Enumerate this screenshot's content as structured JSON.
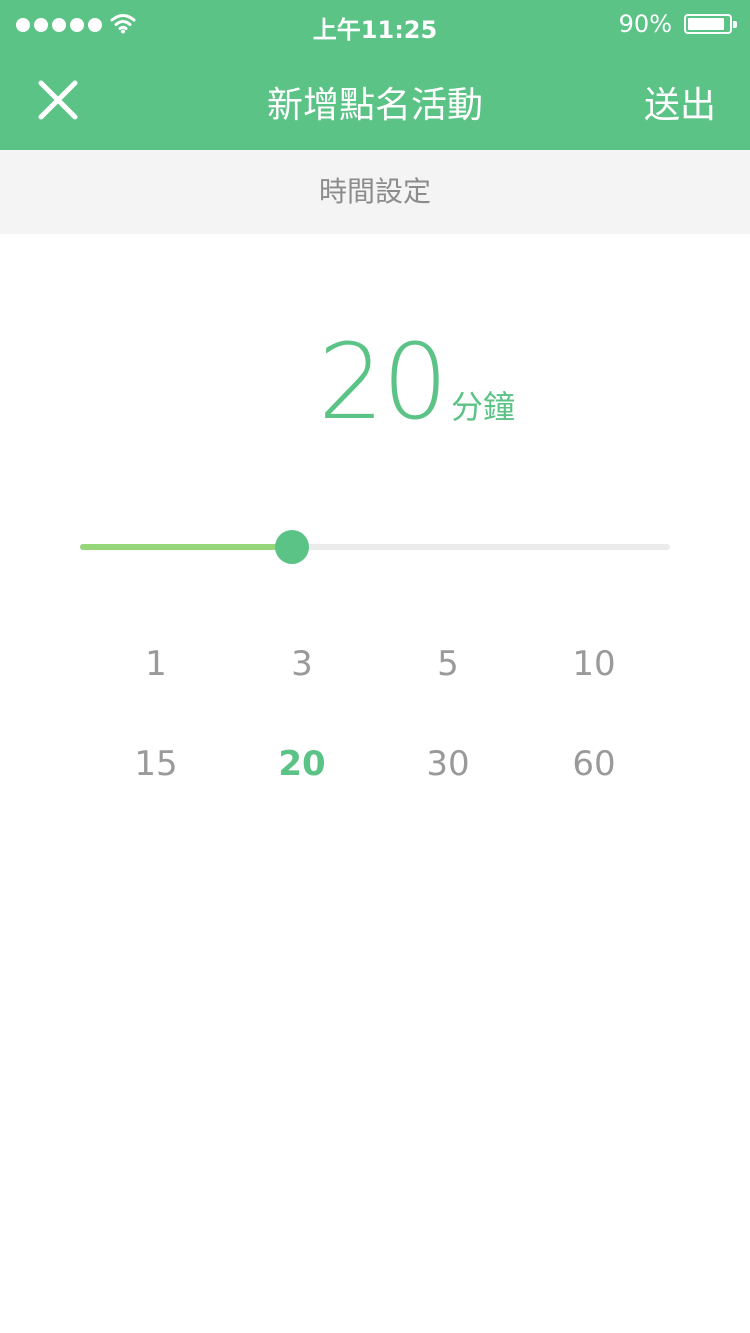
{
  "status_bar": {
    "time": "上午11:25",
    "battery_percent": "90%",
    "battery_level": 0.9,
    "signal_dots": 5,
    "icons": [
      "signal-dots-icon",
      "wifi-icon",
      "battery-icon"
    ]
  },
  "nav": {
    "title": "新增點名活動",
    "close_icon": "close-icon",
    "submit_label": "送出"
  },
  "section": {
    "title": "時間設定"
  },
  "duration": {
    "value": "20",
    "unit": "分鐘"
  },
  "slider": {
    "fraction": 0.36
  },
  "presets": {
    "row1": [
      "1",
      "3",
      "5",
      "10"
    ],
    "row2": [
      "15",
      "20",
      "30",
      "60"
    ],
    "selected": "20"
  },
  "colors": {
    "brand": "#5bc386",
    "slider_fill": "#96d67b",
    "track": "#ebebeb",
    "muted_text": "#9a9a9a",
    "section_bg": "#f4f4f4"
  }
}
